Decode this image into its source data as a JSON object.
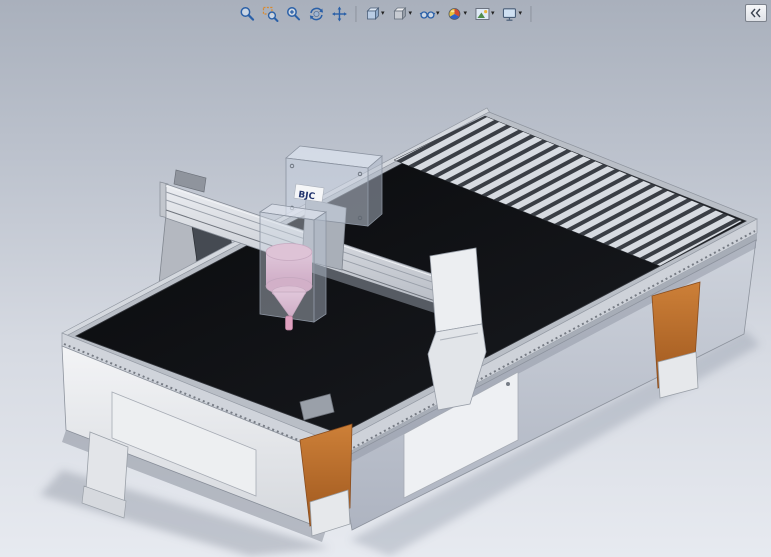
{
  "toolbar": {
    "dropdown_glyph": "▾",
    "items": [
      {
        "name": "zoom-to-fit",
        "icon": "zoom-to-fit-icon",
        "has_dropdown": false
      },
      {
        "name": "zoom-to-area",
        "icon": "zoom-to-area-icon",
        "has_dropdown": false
      },
      {
        "name": "zoom-in-out",
        "icon": "zoom-in-out-icon",
        "has_dropdown": false
      },
      {
        "name": "rotate-view",
        "icon": "rotate-view-icon",
        "has_dropdown": false
      },
      {
        "name": "pan",
        "icon": "pan-icon",
        "has_dropdown": false
      },
      {
        "name": "view-orientation",
        "icon": "view-cube-icon",
        "has_dropdown": true
      },
      {
        "name": "display-style",
        "icon": "shaded-cube-icon",
        "has_dropdown": true
      },
      {
        "name": "hide-show-items",
        "icon": "glasses-icon",
        "has_dropdown": true
      },
      {
        "name": "edit-appearance",
        "icon": "color-sphere-icon",
        "has_dropdown": true
      },
      {
        "name": "apply-scene",
        "icon": "scene-photo-icon",
        "has_dropdown": true
      },
      {
        "name": "view-settings",
        "icon": "monitor-icon",
        "has_dropdown": true
      }
    ]
  },
  "task_pane": {
    "toggle_icon": "collapse-chevrons-icon"
  },
  "viewport": {
    "model_label": "BJC",
    "colors": {
      "background_top": "#a9b0bc",
      "background_bottom": "#e7eaf0",
      "table_surface": "#0b0c0e",
      "slat_light": "#d7dbe1",
      "slat_dark": "#3a3e45",
      "frame_orange": "#c07433",
      "spindle_pink": "#e5aac8",
      "machine_body": "#e9ebee",
      "side_panel": "#c2c8d4",
      "gantry_gray": "#ccd0d7"
    }
  }
}
